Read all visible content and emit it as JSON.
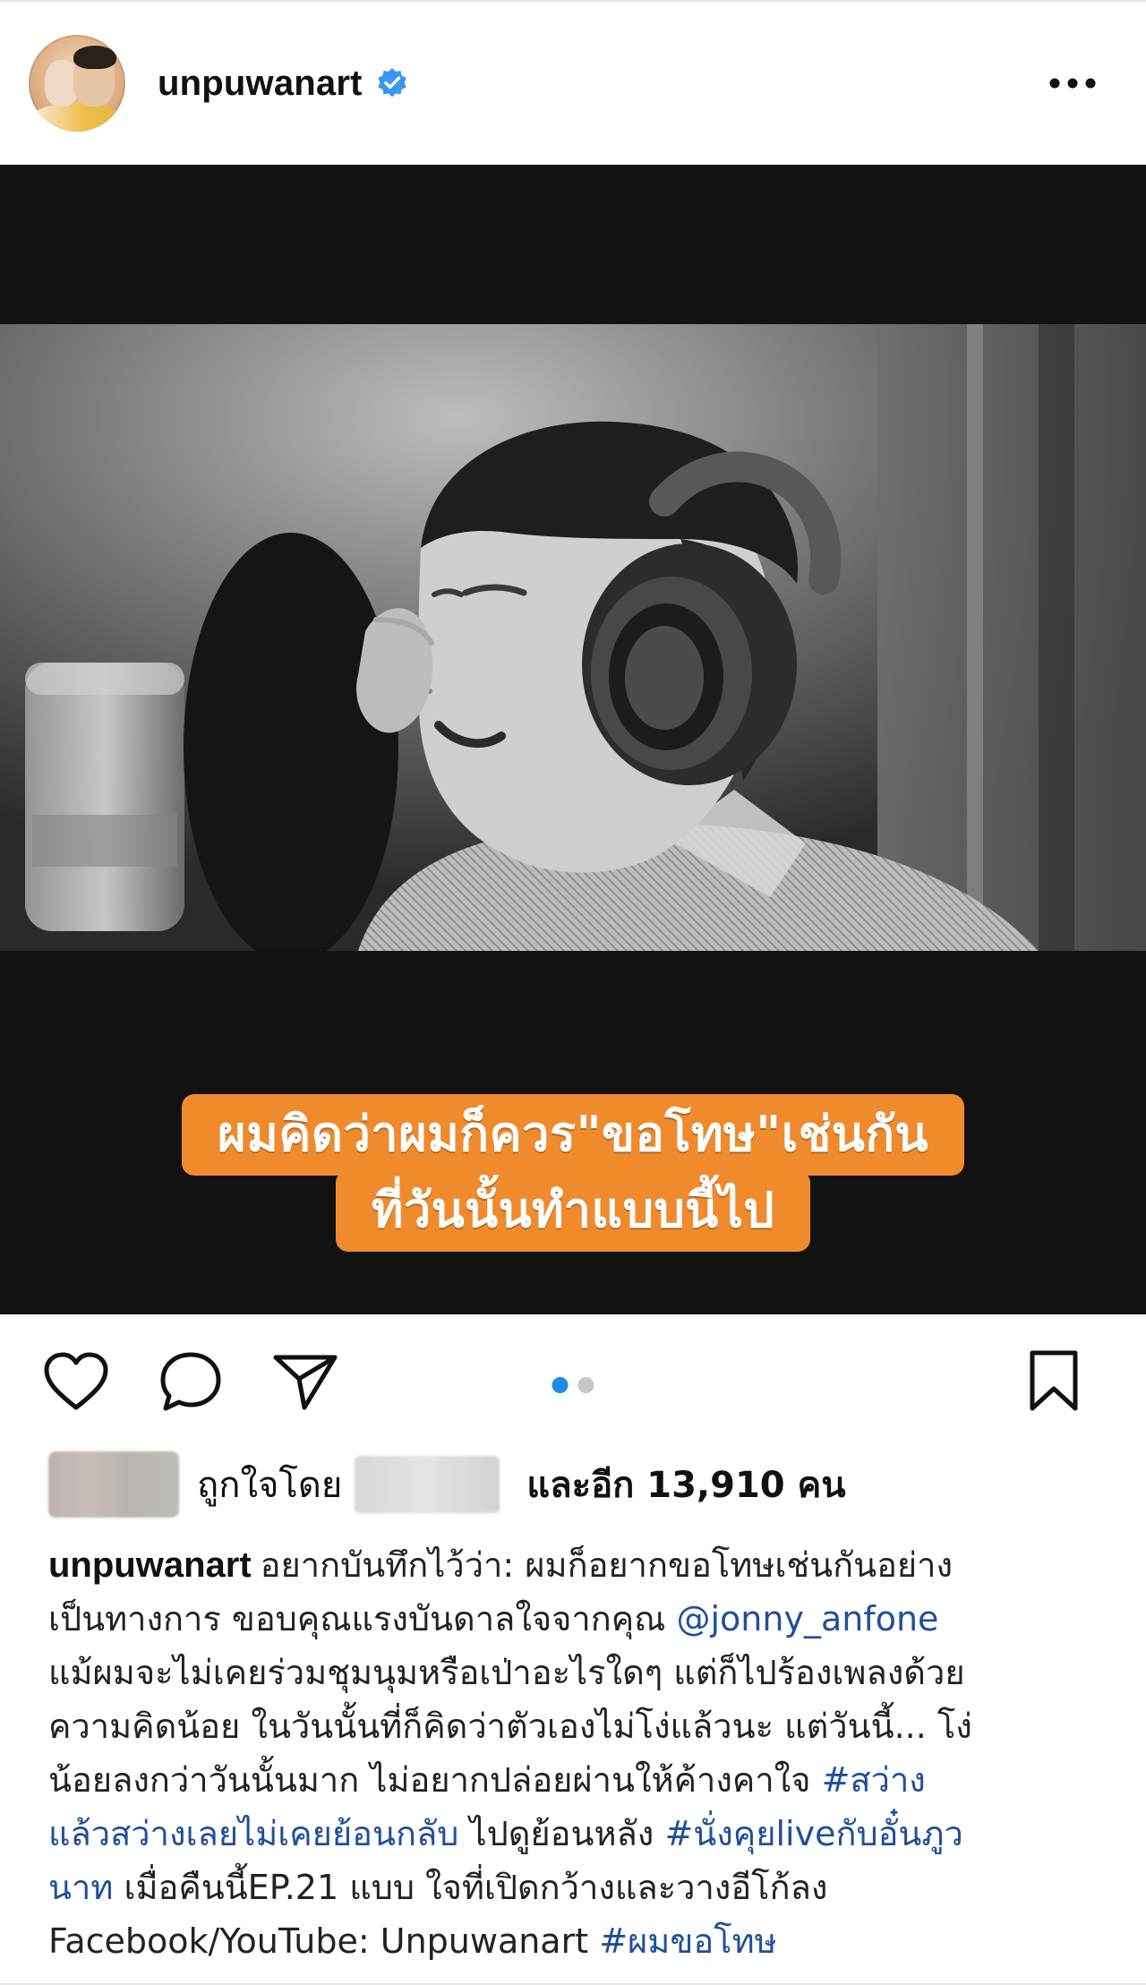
{
  "post": {
    "username": "unpuwanart",
    "verified": true,
    "more_icon": "more-horizontal-icon"
  },
  "media": {
    "subtitle_line_1": "ผมคิดว่าผมก็ควร\"ขอโทษ\"เช่นกัน",
    "subtitle_line_2": "ที่วันนั้นทำแบบนี้ไป",
    "subtitle_color": "#ef8b2c",
    "carousel_total": 2,
    "carousel_active": 1
  },
  "actions": {
    "like_icon": "heart-icon",
    "comment_icon": "comment-icon",
    "share_icon": "send-icon",
    "save_icon": "bookmark-icon"
  },
  "likes": {
    "prefix": "ถูกใจโดย",
    "suffix": "และอีก 13,910 คน"
  },
  "caption": {
    "username": "unpuwanart",
    "line1_text": "อยากบันทึกไว้ว่า: ผมก็อยากขอโทษเช่นกันอย่าง",
    "line2_text": "เป็นทางการ ขอบคุณแรงบันดาลใจจากคุณ ",
    "line2_mention": "@jonny_anfone",
    "line3_text": "แม้ผมจะไม่เคยร่วมชุมนุมหรือเป่าอะไรใดๆ แต่ก็ไปร้องเพลงด้วย",
    "line4_text": "ความคิดน้อย ในวันนั้นที่ก็คิดว่าตัวเองไม่โง่แล้วนะ แต่วันนี้... โง่",
    "line5_text": "น้อยลงกว่าวันนั้นมาก ไม่อยากปล่อยผ่านให้ค้างคาใจ ",
    "line5_tag": "#สว่าง",
    "line6_tag": "แล้วสว่างเลยไม่เคยย้อนกลับ",
    "line6_text": " ไปดูย้อนหลัง ",
    "line6_tag2": "#นั่งคุยliveกับอั๋นภูว",
    "line7_tag": "นาท",
    "line7_text": " เมื่อคืนนี้EP.21 แบบ ใจที่เปิดกว้างและวางอีโก้ลง",
    "line8_text": "Facebook/YouTube: Unpuwanart ",
    "line8_tag": "#ผมขอโทษ",
    "link_color": "#1f4f9a"
  }
}
